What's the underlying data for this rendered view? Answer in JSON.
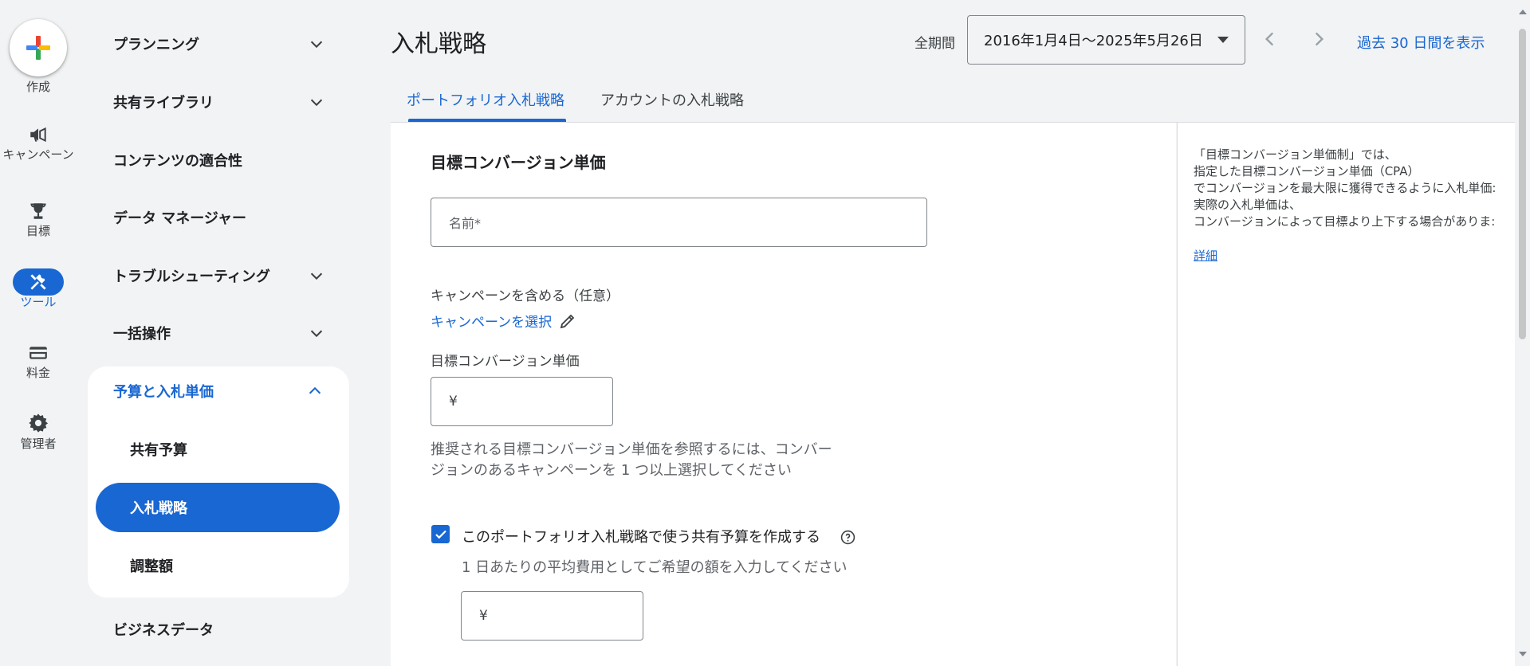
{
  "rail": {
    "create_label": "作成",
    "items": [
      {
        "label": "キャンペーン",
        "icon": "megaphone-icon"
      },
      {
        "label": "目標",
        "icon": "trophy-icon"
      },
      {
        "label": "ツール",
        "icon": "tools-icon"
      },
      {
        "label": "料金",
        "icon": "credit-card-icon"
      },
      {
        "label": "管理者",
        "icon": "gear-icon"
      }
    ]
  },
  "nav": {
    "items": [
      {
        "label": "プランニング"
      },
      {
        "label": "共有ライブラリ"
      },
      {
        "label": "コンテンツの適合性"
      },
      {
        "label": "データ マネージャー"
      },
      {
        "label": "トラブルシューティング"
      },
      {
        "label": "一括操作"
      }
    ],
    "group": {
      "label": "予算と入札単価",
      "sub_items": [
        "共有予算",
        "入札戦略",
        "調整額"
      ]
    },
    "footer_item": "ビジネスデータ"
  },
  "header": {
    "title": "入札戦略",
    "period_label": "全期間",
    "date_range": "2016年1月4日〜2025年5月26日",
    "last30_label": "過去 30 日間を表示"
  },
  "tabs": [
    {
      "label": "ポートフォリオ入札戦略",
      "active": true
    },
    {
      "label": "アカウントの入札戦略",
      "active": false
    }
  ],
  "form": {
    "section_title": "目標コンバージョン単価",
    "name_placeholder": "名前*",
    "include_campaigns_label": "キャンペーンを含める（任意）",
    "select_campaigns_link": "キャンペーンを選択",
    "target_cpa_label": "目標コンバージョン単価",
    "currency_symbol": "¥",
    "helper_text_line1": "推奨される目標コンバージョン単価を参照するには、コンバー",
    "helper_text_line2": "ジョンのあるキャンペーンを 1 つ以上選択してください",
    "shared_budget_checkbox_label": "このポートフォリオ入札戦略で使う共有予算を作成する",
    "shared_budget_checked": true,
    "shared_budget_subtext": "1 日あたりの平均費用としてご希望の額を入力してください",
    "budget_currency_symbol": "¥"
  },
  "side_panel": {
    "lines": [
      "「目標コンバージョン単価制」では、",
      "指定した目標コンバージョン単価（CPA）",
      "でコンバージョンを最大限に獲得できるように入札単価:",
      "実際の入札単価は、",
      "コンバージョンによって目標より上下する場合がありま:"
    ],
    "details_link": "詳細"
  },
  "colors": {
    "accent": "#1967d2",
    "background": "#f1f3f4"
  }
}
